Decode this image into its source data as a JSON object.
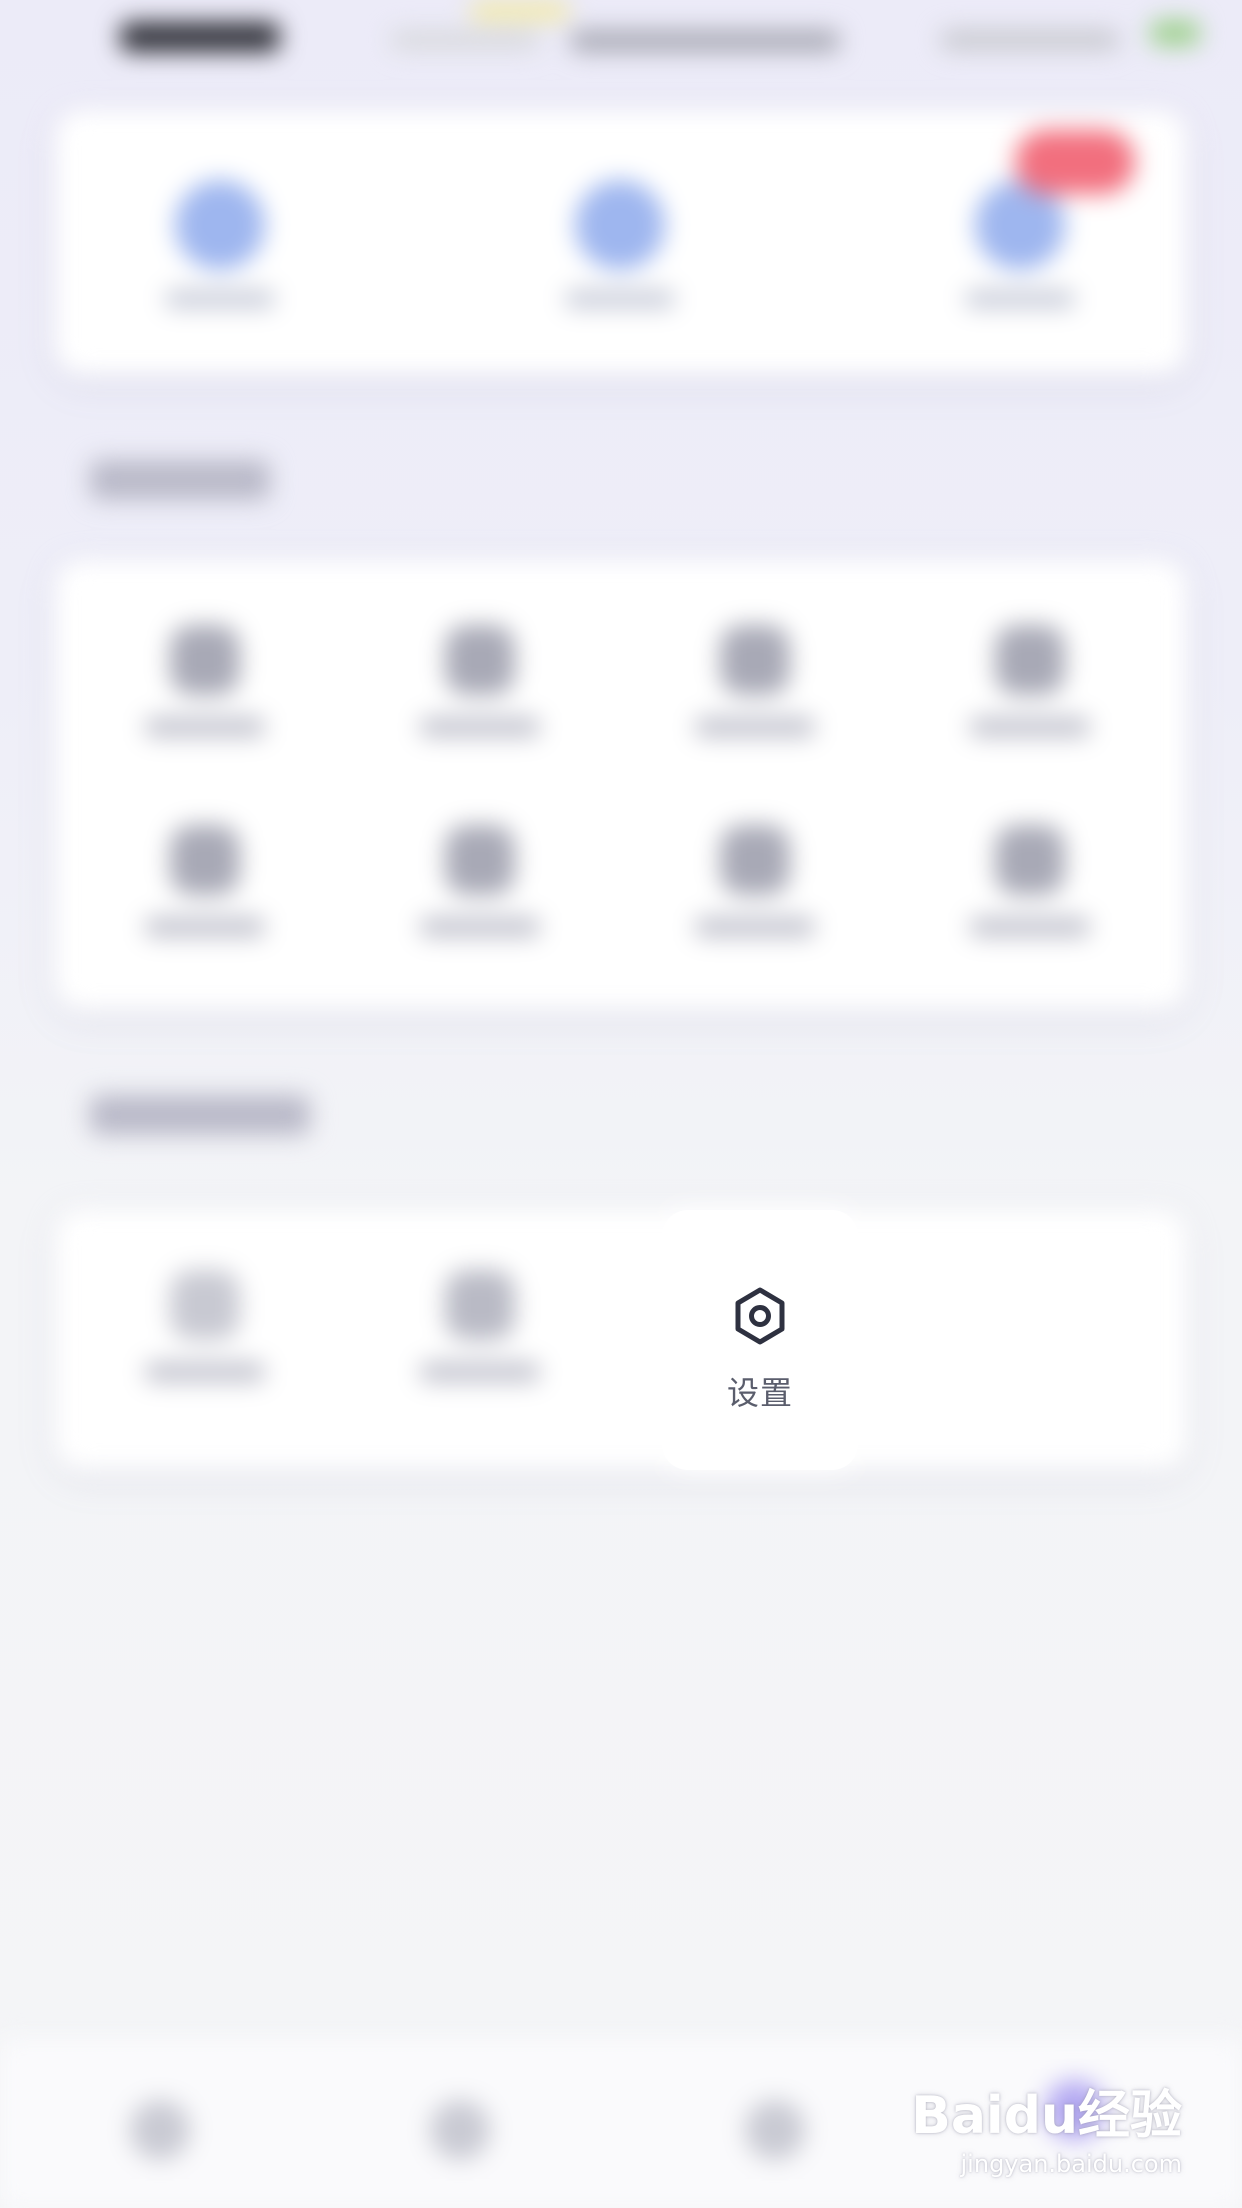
{
  "settings_item": {
    "label": "设置",
    "icon": "settings-hexagon-icon"
  },
  "watermark": {
    "brand": "Baidu经验",
    "url": "jingyan.baidu.com"
  },
  "colors": {
    "icon_dark": "#2e3140",
    "label_gray": "#5a5d6c",
    "badge_red": "#f26f7e",
    "accent_blue": "#9eb6ef",
    "accent_purple": "#b3a8f2"
  }
}
